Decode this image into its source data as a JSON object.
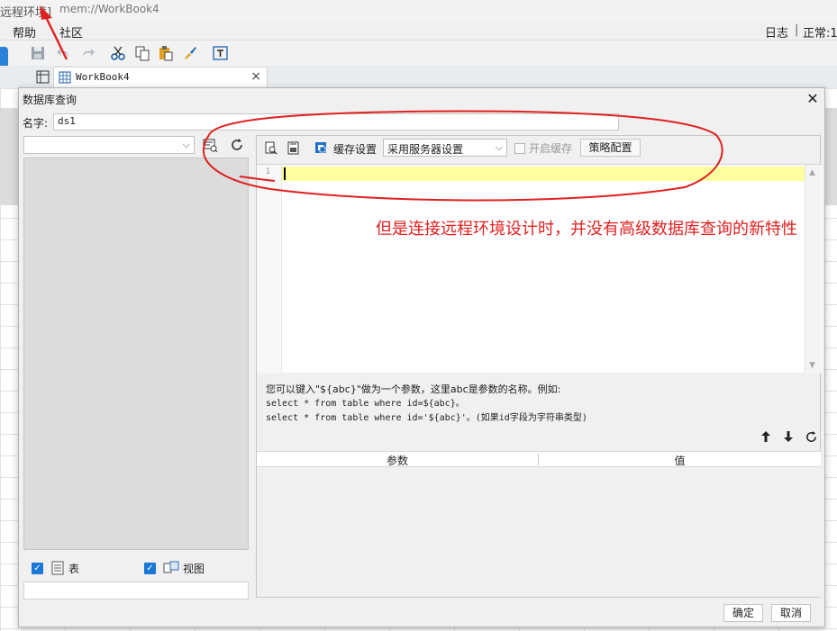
{
  "app": {
    "title_left": "远程环境]",
    "title_path": "mem://WorkBook4",
    "menu": {
      "help": "帮助",
      "community": "社区"
    },
    "status": {
      "log": "日志",
      "separator": "|",
      "normal": "正常:1"
    },
    "tab": {
      "label": "WorkBook4"
    }
  },
  "dialog": {
    "title": "数据库查询",
    "name_label": "名字:",
    "name_value": "ds1",
    "left": {
      "tables_label": "表",
      "views_label": "视图"
    },
    "toolbar": {
      "cache_label": "缓存设置",
      "cache_option": "采用服务器设置",
      "enable_cache_label": "开启缓存",
      "strategy_button": "策略配置"
    },
    "editor": {
      "line_number": "1"
    },
    "annotation": "但是连接远程环境设计时，并没有高级数据库查询的新特性",
    "hint": {
      "line1": "您可以键入\"${abc}\"做为一个参数，这里abc是参数的名称。例如:",
      "line2": "select * from table where id=${abc}。",
      "line3": "select * from table where id='${abc}'。(如果id字段为字符串类型)"
    },
    "params": {
      "col_param": "参数",
      "col_value": "值"
    },
    "ok_button": "确定",
    "cancel_button": "取消"
  },
  "colors": {
    "accent": "#1b78d6",
    "annotation": "#e02020",
    "current_line": "#ffff9f"
  }
}
